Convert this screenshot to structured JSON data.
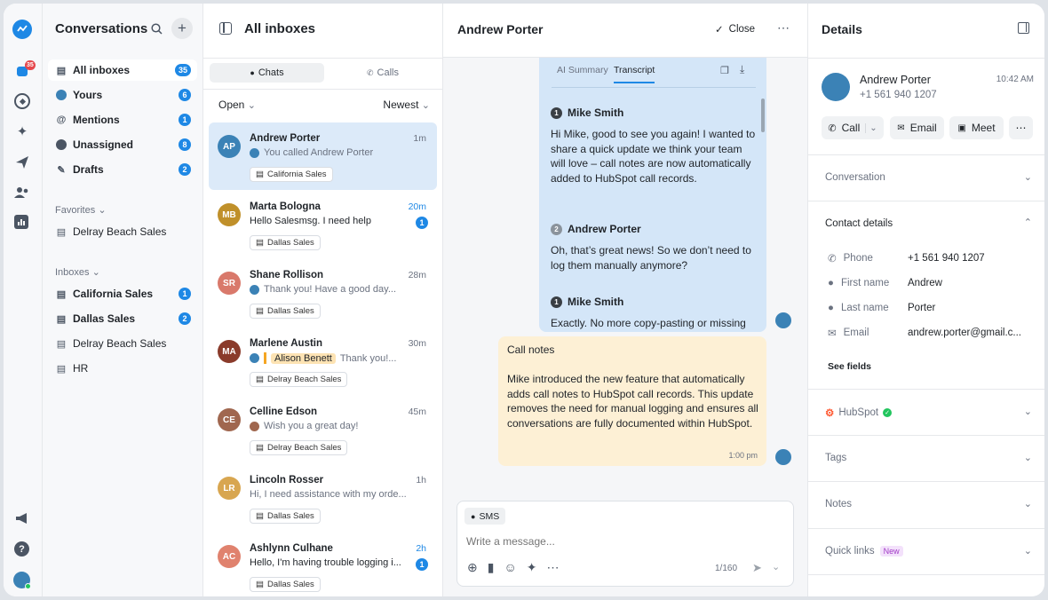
{
  "rail": {
    "icons": [
      "logo-icon",
      "inbox-icon",
      "compass-icon",
      "sparkle-icon",
      "send-icon",
      "contacts-icon",
      "reports-icon"
    ],
    "notif_count": "35",
    "bottom_icons": [
      "megaphone-icon",
      "help-icon"
    ]
  },
  "nav": {
    "title": "Conversations",
    "items": [
      {
        "label": "All inboxes",
        "count": "35"
      },
      {
        "label": "Yours",
        "count": "6"
      },
      {
        "label": "Mentions",
        "count": "1"
      },
      {
        "label": "Unassigned",
        "count": "8"
      },
      {
        "label": "Drafts",
        "count": "2"
      }
    ],
    "favorites_label": "Favorites",
    "favorites": [
      {
        "label": "Delray Beach Sales"
      }
    ],
    "inboxes_label": "Inboxes",
    "inboxes": [
      {
        "label": "California Sales",
        "count": "1"
      },
      {
        "label": "Dallas Sales",
        "count": "2"
      },
      {
        "label": "Delray Beach Sales",
        "count": ""
      },
      {
        "label": "HR",
        "count": ""
      }
    ]
  },
  "inbox": {
    "title": "All inboxes",
    "tabs": [
      "Chats",
      "Calls"
    ],
    "filter": "Open",
    "sort": "Newest",
    "conversations": [
      {
        "name": "Andrew Porter",
        "time": "1m",
        "preview": "You called Andrew Porter",
        "tag": "California Sales",
        "unread": "",
        "avatar_color": "#3b82b6",
        "initials": "AP"
      },
      {
        "name": "Marta Bologna",
        "time": "20m",
        "preview": "Hello Salesmsg. I need help",
        "tag": "Dallas Sales",
        "unread": "1",
        "avatar_color": "#c0902a",
        "initials": "MB"
      },
      {
        "name": "Shane Rollison",
        "time": "28m",
        "preview": "Thank you! Have a good day...",
        "tag": "Dallas Sales",
        "unread": "",
        "avatar_color": "#d9796b",
        "initials": "SR"
      },
      {
        "name": "Marlene Austin",
        "time": "30m",
        "mention": "Alison Benett",
        "preview": "Thank you!...",
        "tag": "Delray Beach Sales",
        "unread": "",
        "avatar_color": "#8a3b2b",
        "initials": "MA"
      },
      {
        "name": "Celline Edson",
        "time": "45m",
        "preview": "Wish you a great day!",
        "tag": "Delray Beach Sales",
        "unread": "",
        "avatar_color": "#a0674f",
        "initials": "CE"
      },
      {
        "name": "Lincoln Rosser",
        "time": "1h",
        "preview": "Hi, I need assistance with my orde...",
        "tag": "Dallas Sales",
        "unread": "",
        "avatar_color": "#d8a650",
        "initials": "LR"
      },
      {
        "name": "Ashlynn Culhane",
        "time": "2h",
        "preview": "Hello, I'm having trouble logging i...",
        "tag": "Dallas Sales",
        "unread": "1",
        "avatar_color": "#e0826e",
        "initials": "AC"
      }
    ]
  },
  "chat": {
    "contact": "Andrew Porter",
    "close_label": "Close",
    "panel_tabs": [
      "AI Summary",
      "Transcript"
    ],
    "transcript": [
      {
        "num": "1",
        "speaker": "Mike Smith",
        "text": "Hi Mike, good to see you again! I wanted to share a quick update we think your team will love – call notes are now automatically added to HubSpot call records."
      },
      {
        "num": "2",
        "speaker": "Andrew Porter",
        "text": "Oh, that’s great news! So we don’t need to log them manually anymore?"
      },
      {
        "num": "1",
        "speaker": "Mike Smith",
        "text": "Exactly. No more copy-pasting or missing"
      }
    ],
    "notes": {
      "title": "Call notes",
      "body": "Mike introduced the new feature that automatically adds call notes to HubSpot call records. This update removes the need for manual logging and ensures all conversations are fully documented within HubSpot.",
      "time": "1:00 pm"
    },
    "composer": {
      "channel": "SMS",
      "placeholder": "Write a message...",
      "counter": "1/160"
    }
  },
  "details": {
    "title": "Details",
    "name": "Andrew Porter",
    "phone": "+1 561 940 1207",
    "time": "10:42 AM",
    "actions": [
      "Call",
      "Email",
      "Meet"
    ],
    "sections": {
      "conversation": "Conversation",
      "contact": "Contact details",
      "hubspot": "HubSpot",
      "tags": "Tags",
      "notes": "Notes",
      "quicklinks": "Quick links",
      "new_badge": "New"
    },
    "fields": [
      {
        "label": "Phone",
        "value": "+1 561 940 1207"
      },
      {
        "label": "First name",
        "value": "Andrew"
      },
      {
        "label": "Last name",
        "value": "Porter"
      },
      {
        "label": "Email",
        "value": "andrew.porter@gmail.c..."
      }
    ],
    "see_fields": "See fields"
  }
}
